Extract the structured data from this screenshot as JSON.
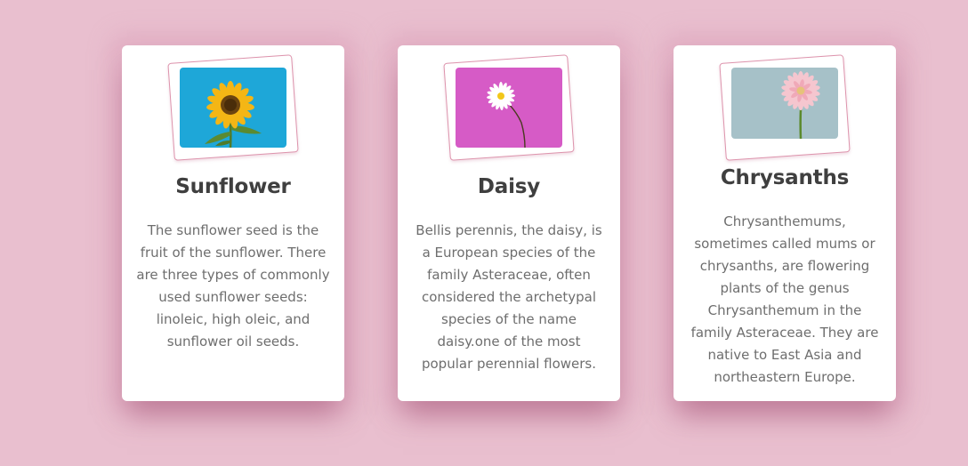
{
  "cards": [
    {
      "title": "Sunflower",
      "description": "The sunflower seed is the fruit of the sunflower. There are three types of commonly used sunflower seeds: linoleic, high oleic, and sunflower oil seeds.",
      "image": {
        "subject": "sunflower",
        "background": "#1ea7d8"
      }
    },
    {
      "title": "Daisy",
      "description": "Bellis perennis, the daisy, is a European species of the family Asteraceae, often considered the archetypal species of the name daisy.one of the most popular perennial flowers.",
      "image": {
        "subject": "daisy",
        "background": "#d65bc6"
      }
    },
    {
      "title": "Chrysanths",
      "description": "Chrysanthemums, sometimes called mums or chrysanths, are flowering plants of the genus Chrysanthemum in the family Asteraceae. They are native to East Asia and northeastern Europe.",
      "image": {
        "subject": "pink gerbera flower",
        "background": "#a6c1c8"
      }
    }
  ],
  "colors": {
    "page_background": "#e9bfcf",
    "card_background": "#ffffff",
    "frame_border": "#dd93ac",
    "title_text": "#3f3f3f",
    "body_text": "#6e6e6e"
  }
}
